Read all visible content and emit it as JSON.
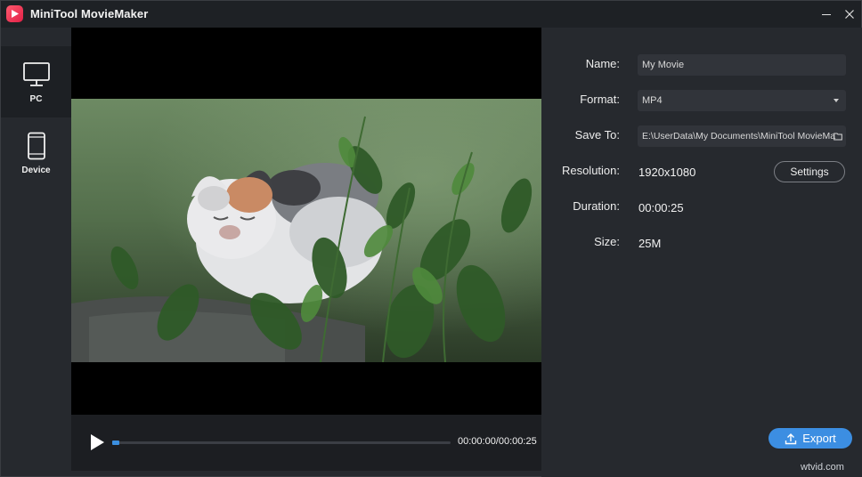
{
  "app": {
    "title": "MiniTool MovieMaker"
  },
  "window_controls": {
    "minimize": "—",
    "close": "✕"
  },
  "sidebar": {
    "items": [
      {
        "label": "PC",
        "icon": "monitor-icon",
        "active": true
      },
      {
        "label": "Device",
        "icon": "phone-icon",
        "active": false
      }
    ]
  },
  "player": {
    "timecode": "00:00:00/00:00:25",
    "progress": 0
  },
  "export_form": {
    "name_label": "Name:",
    "name_value": "My Movie",
    "format_label": "Format:",
    "format_value": "MP4",
    "save_label": "Save To:",
    "save_value": "E:\\UserData\\My Documents\\MiniTool MovieMa",
    "resolution_label": "Resolution:",
    "resolution_value": "1920x1080",
    "settings_button": "Settings",
    "duration_label": "Duration:",
    "duration_value": "00:00:25",
    "size_label": "Size:",
    "size_value": "25M",
    "export_button": "Export"
  },
  "watermark": "wtvid.com",
  "colors": {
    "accent": "#3c8ee2",
    "brand": "#e02046"
  }
}
